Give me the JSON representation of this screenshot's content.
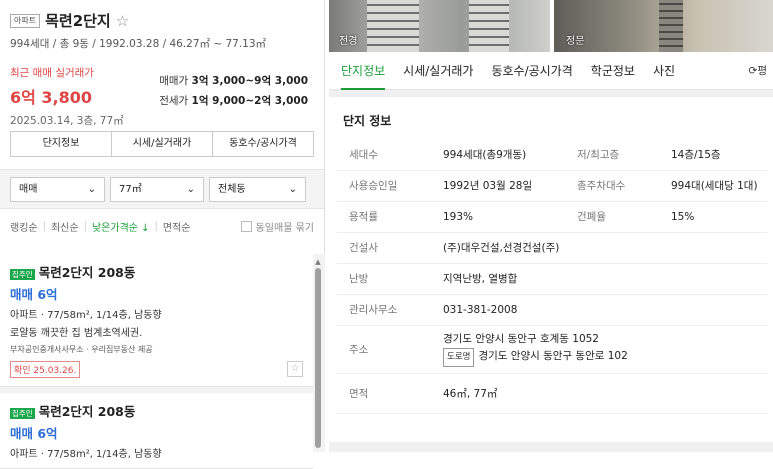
{
  "complex": {
    "badge": "아파트",
    "name": "목련2단지",
    "star": "☆",
    "summary": "994세대 / 총 9동 / 1992.03.28 / 46.27㎡ ~ 77.13㎡"
  },
  "recent": {
    "label": "최근 매매 실거래가",
    "price": "6억 3,800",
    "date": "2025.03.14, 3층, 77㎡"
  },
  "ranges": {
    "sale_label": "매매가",
    "sale_value": "3억 3,000~9억 3,000",
    "jeonse_label": "전세가",
    "jeonse_value": "1억 9,000~2억 3,000"
  },
  "left_buttons": [
    "단지정보",
    "시세/실거래가",
    "동호수/공시가격"
  ],
  "filters": {
    "type": "매매",
    "area": "77㎡",
    "dong": "전체동",
    "chevron": "chevron-down-icon"
  },
  "sort": {
    "items": [
      "랭킹순",
      "최신순",
      "낮은가격순 ↓",
      "면적순"
    ],
    "checkbox_label": "동일매물 묶기"
  },
  "listings": [
    {
      "tag": "집주인",
      "name": "목련2단지 208동",
      "price": "매매 6억",
      "spec": "아파트 · 77/58m², 1/14층, 남동향",
      "desc": "로얄동 깨끗한 집 범계초역세권.",
      "source": "부자공인중개사사무소 · 우리집부동산 제공",
      "confirm": "확인 25.03.26.",
      "fav": "☆"
    },
    {
      "tag": "집주인",
      "name": "목련2단지 208동",
      "price": "매매 6억",
      "spec": "아파트 · 77/58m², 1/14층, 남동향"
    }
  ],
  "photos": [
    {
      "label": "전경"
    },
    {
      "label": "정문"
    }
  ],
  "tabs": [
    "단지정보",
    "시세/실거래가",
    "동호수/공시가격",
    "학군정보",
    "사진"
  ],
  "tab_right": "평",
  "info": {
    "title": "단지 정보",
    "rows": [
      {
        "k": "세대수",
        "v": "994세대(총9개동)",
        "k2": "저/최고층",
        "v2": "14층/15층"
      },
      {
        "k": "사용승인일",
        "v": "1992년 03월 28일",
        "k2": "총주차대수",
        "v2": "994대(세대당 1대)"
      },
      {
        "k": "용적률",
        "v": "193%",
        "k2": "건폐율",
        "v2": "15%"
      }
    ],
    "builder_k": "건설사",
    "builder_v": "(주)대우건설,선경건설(주)",
    "heat_k": "난방",
    "heat_v": "지역난방, 열병합",
    "office_k": "관리사무소",
    "office_v": "031-381-2008",
    "addr_k": "주소",
    "addr_v1": "경기도 안양시 동안구 호계동 1052",
    "road_tag": "도로명",
    "addr_v2": "경기도 안양시 동안구 동안로 102",
    "area_k": "면적",
    "area_v": "46㎡, 77㎡"
  }
}
